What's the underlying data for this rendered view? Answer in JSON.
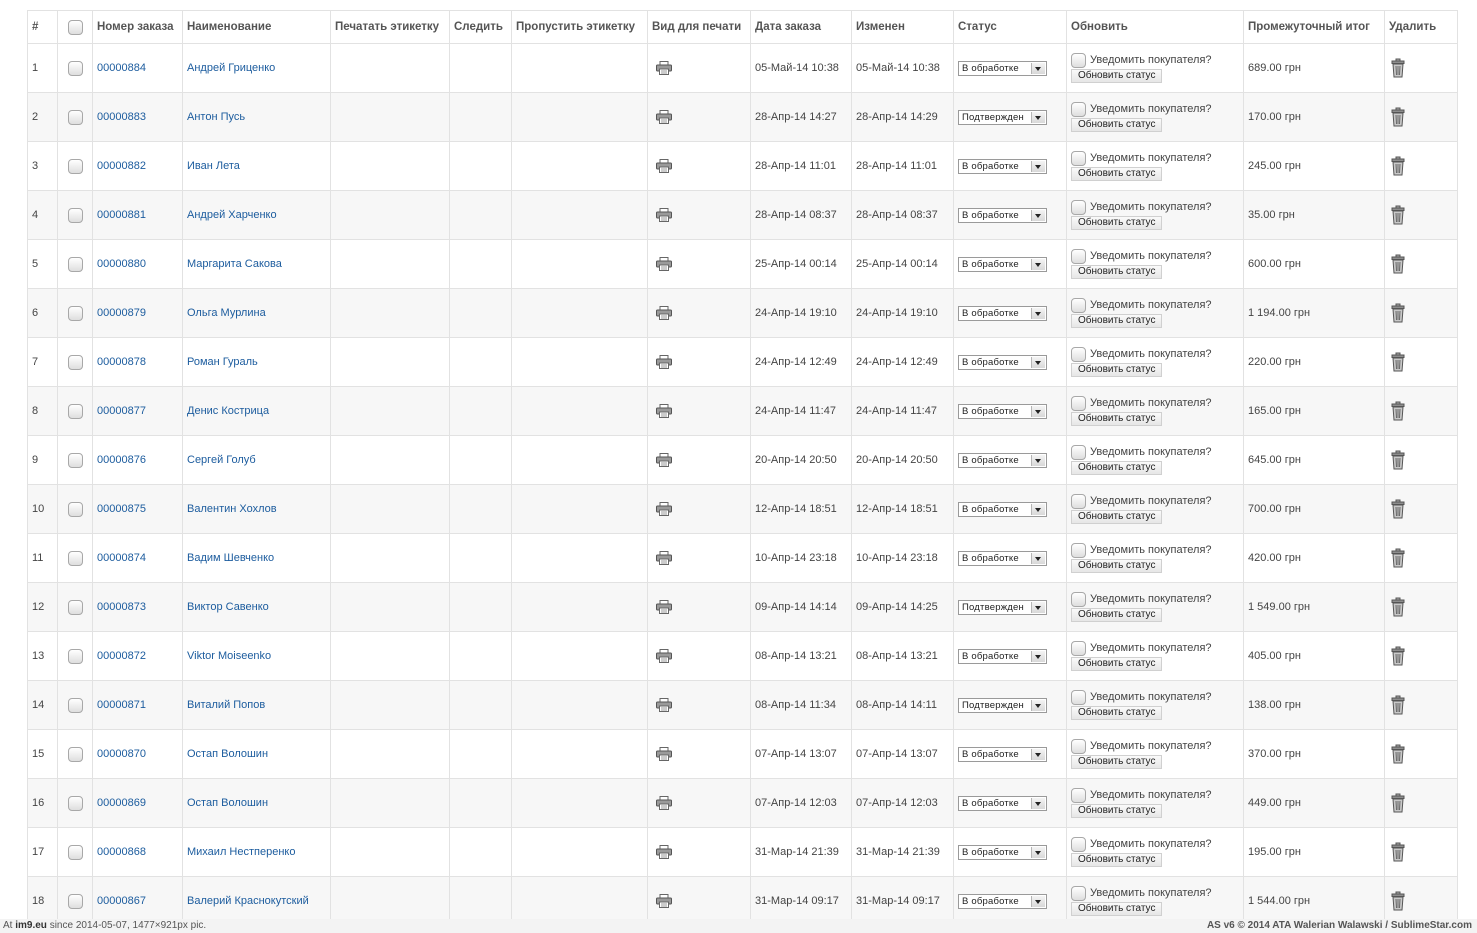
{
  "columns": [
    "#",
    "",
    "Номер заказа",
    "Наименование",
    "Печатать этикетку",
    "Следить",
    "Пропустить этикетку",
    "Вид для печати",
    "Дата заказа",
    "Изменен",
    "Статус",
    "Обновить",
    "Промежуточный итог",
    "Удалить"
  ],
  "notify_label": "Уведомить покупателя?",
  "update_button_label": "Обновить статус",
  "icons": {
    "print": "printer-icon",
    "delete": "trash-icon"
  },
  "colors": {
    "link": "#1c5c9e",
    "row_alt": "#f7f7f7",
    "border": "#e2e2e2"
  },
  "orders": [
    {
      "n": "1",
      "order": "00000884",
      "name": "Андрей Гриценко",
      "date": "05-Май-14 10:38",
      "modified": "05-Май-14 10:38",
      "status": "В обработке",
      "total": "689.00 грн"
    },
    {
      "n": "2",
      "order": "00000883",
      "name": "Антон Пусь",
      "date": "28-Апр-14 14:27",
      "modified": "28-Апр-14 14:29",
      "status": "Подтвержден",
      "total": "170.00 грн"
    },
    {
      "n": "3",
      "order": "00000882",
      "name": "Иван Лета",
      "date": "28-Апр-14 11:01",
      "modified": "28-Апр-14 11:01",
      "status": "В обработке",
      "total": "245.00 грн"
    },
    {
      "n": "4",
      "order": "00000881",
      "name": "Андрей Харченко",
      "date": "28-Апр-14 08:37",
      "modified": "28-Апр-14 08:37",
      "status": "В обработке",
      "total": "35.00 грн"
    },
    {
      "n": "5",
      "order": "00000880",
      "name": "Маргарита Сакова",
      "date": "25-Апр-14 00:14",
      "modified": "25-Апр-14 00:14",
      "status": "В обработке",
      "total": "600.00 грн"
    },
    {
      "n": "6",
      "order": "00000879",
      "name": "Ольга Мурлина",
      "date": "24-Апр-14 19:10",
      "modified": "24-Апр-14 19:10",
      "status": "В обработке",
      "total": "1 194.00 грн"
    },
    {
      "n": "7",
      "order": "00000878",
      "name": "Роман Гураль",
      "date": "24-Апр-14 12:49",
      "modified": "24-Апр-14 12:49",
      "status": "В обработке",
      "total": "220.00 грн"
    },
    {
      "n": "8",
      "order": "00000877",
      "name": "Денис Кострица",
      "date": "24-Апр-14 11:47",
      "modified": "24-Апр-14 11:47",
      "status": "В обработке",
      "total": "165.00 грн"
    },
    {
      "n": "9",
      "order": "00000876",
      "name": "Сергей Голуб",
      "date": "20-Апр-14 20:50",
      "modified": "20-Апр-14 20:50",
      "status": "В обработке",
      "total": "645.00 грн"
    },
    {
      "n": "10",
      "order": "00000875",
      "name": "Валентин Хохлов",
      "date": "12-Апр-14 18:51",
      "modified": "12-Апр-14 18:51",
      "status": "В обработке",
      "total": "700.00 грн"
    },
    {
      "n": "11",
      "order": "00000874",
      "name": "Вадим Шевченко",
      "date": "10-Апр-14 23:18",
      "modified": "10-Апр-14 23:18",
      "status": "В обработке",
      "total": "420.00 грн"
    },
    {
      "n": "12",
      "order": "00000873",
      "name": "Виктор Савенко",
      "date": "09-Апр-14 14:14",
      "modified": "09-Апр-14 14:25",
      "status": "Подтвержден",
      "total": "1 549.00 грн"
    },
    {
      "n": "13",
      "order": "00000872",
      "name": "Viktor Moiseenko",
      "date": "08-Апр-14 13:21",
      "modified": "08-Апр-14 13:21",
      "status": "В обработке",
      "total": "405.00 грн"
    },
    {
      "n": "14",
      "order": "00000871",
      "name": "Виталий Попов",
      "date": "08-Апр-14 11:34",
      "modified": "08-Апр-14 14:11",
      "status": "Подтвержден",
      "total": "138.00 грн"
    },
    {
      "n": "15",
      "order": "00000870",
      "name": "Остап Волошин",
      "date": "07-Апр-14 13:07",
      "modified": "07-Апр-14 13:07",
      "status": "В обработке",
      "total": "370.00 грн"
    },
    {
      "n": "16",
      "order": "00000869",
      "name": "Остап Волошин",
      "date": "07-Апр-14 12:03",
      "modified": "07-Апр-14 12:03",
      "status": "В обработке",
      "total": "449.00 грн"
    },
    {
      "n": "17",
      "order": "00000868",
      "name": "Михаил Нестперенко",
      "date": "31-Мар-14 21:39",
      "modified": "31-Мар-14 21:39",
      "status": "В обработке",
      "total": "195.00 грн"
    },
    {
      "n": "18",
      "order": "00000867",
      "name": "Валерий Краснокутский",
      "date": "31-Мар-14 09:17",
      "modified": "31-Мар-14 09:17",
      "status": "В обработке",
      "total": "1 544.00 грн"
    }
  ],
  "footer": {
    "left_prefix": "At",
    "left_site": "im9.eu",
    "left_rest": "since 2014-05-07, 1477×921px pic.",
    "right": "AS v6 © 2014 ATA Walerian Walawski / SublimeStar.com"
  }
}
